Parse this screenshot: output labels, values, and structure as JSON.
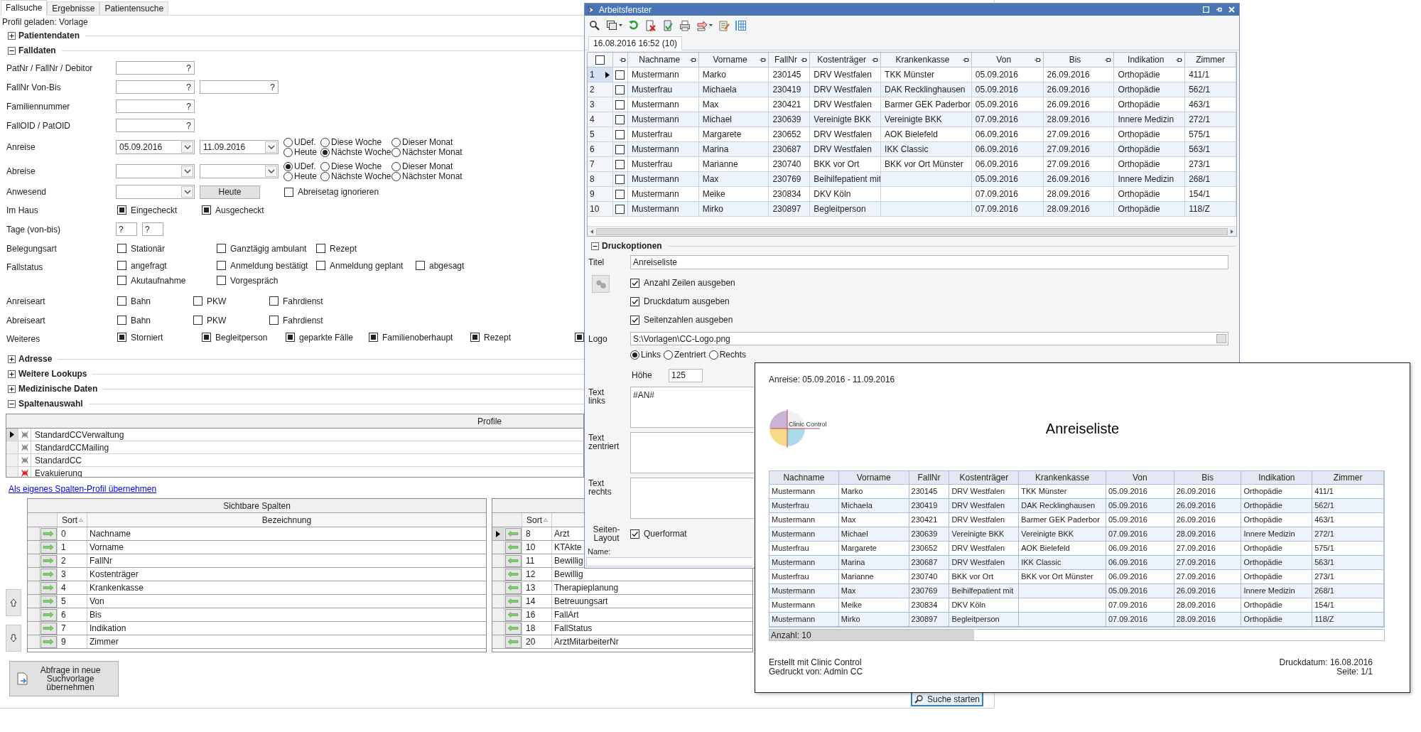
{
  "search_form": {
    "tabs": [
      {
        "label": "Fallsuche",
        "selected": true
      },
      {
        "label": "Ergebnisse",
        "selected": false
      },
      {
        "label": "Patientensuche",
        "selected": false
      }
    ],
    "profile_status": "Profil geladen: Vorlage",
    "sections_before": [
      {
        "label": "Patientendaten",
        "expanded": false
      },
      {
        "label": "Falldaten",
        "expanded": true
      }
    ],
    "falldaten_rows": [
      {
        "label": "PatNr / FallNr / Debitor",
        "items": [
          {
            "kind": "hint_field",
            "value": "?"
          }
        ]
      },
      {
        "label": "FallNr Von-Bis",
        "items": [
          {
            "kind": "hint_field",
            "value": "?"
          },
          {
            "kind": "hint_field",
            "value": "?"
          }
        ]
      },
      {
        "label": "Familiennummer",
        "items": [
          {
            "kind": "hint_field",
            "value": "?"
          }
        ]
      },
      {
        "label": "FallOID / PatOID",
        "items": [
          {
            "kind": "hint_field",
            "value": "?"
          }
        ]
      },
      {
        "label": "Anreise",
        "items": [
          {
            "kind": "date",
            "value": "05.09.2016"
          },
          {
            "kind": "date",
            "value": "11.09.2016"
          },
          {
            "kind": "radios",
            "options": [
              {
                "label": "UDef.",
                "selected": false
              },
              {
                "label": "Heute",
                "selected": false
              },
              {
                "label": "Diese Woche",
                "selected": false
              },
              {
                "label": "Nächste Woche",
                "selected": true
              },
              {
                "label": "Dieser Monat",
                "selected": false
              },
              {
                "label": "Nächster Monat",
                "selected": false
              }
            ]
          }
        ]
      },
      {
        "label": "Abreise",
        "items": [
          {
            "kind": "date"
          },
          {
            "kind": "date"
          },
          {
            "kind": "radios",
            "options": [
              {
                "label": "UDef.",
                "selected": true
              },
              {
                "label": "Heute",
                "selected": false
              },
              {
                "label": "Diese Woche",
                "selected": false
              },
              {
                "label": "Nächste Woche",
                "selected": false
              },
              {
                "label": "Dieser Monat",
                "selected": false
              },
              {
                "label": "Nächster Monat",
                "selected": false
              }
            ]
          }
        ]
      },
      {
        "label": "Anwesend",
        "items": [
          {
            "kind": "date"
          },
          {
            "kind": "button",
            "label": "Heute"
          },
          {
            "kind": "checkbox",
            "label": "Abreisetag ignorieren",
            "checked": false
          }
        ]
      },
      {
        "label": "Im Haus",
        "items": [
          {
            "kind": "checkbox",
            "label": "Eingecheckt",
            "checked": true
          },
          {
            "kind": "checkbox",
            "label": "Ausgecheckt",
            "checked": true
          }
        ]
      },
      {
        "label": "Tage (von-bis)",
        "items": [
          {
            "kind": "small_field",
            "value": "?"
          },
          {
            "kind": "small_field",
            "value": "?"
          }
        ]
      },
      {
        "label": "Belegungsart",
        "items": [
          {
            "kind": "checkbox",
            "label": "Stationär",
            "checked": false
          },
          {
            "kind": "checkbox",
            "label": "Ganztägig ambulant",
            "checked": false
          },
          {
            "kind": "checkbox",
            "label": "Rezept",
            "checked": false
          }
        ]
      },
      {
        "label": "Fallstatus",
        "items": [
          {
            "kind": "checkbox",
            "label": "angefragt",
            "checked": false
          },
          {
            "kind": "checkbox",
            "label": "Anmeldung bestätigt",
            "checked": false
          },
          {
            "kind": "checkbox",
            "label": "Anmeldung geplant",
            "checked": false
          },
          {
            "kind": "checkbox",
            "label": "abgesagt",
            "checked": false
          },
          {
            "kind": "checkbox",
            "label": "Akutaufnahme",
            "checked": false
          },
          {
            "kind": "checkbox",
            "label": "Vorgespräch",
            "checked": false
          }
        ]
      },
      {
        "label": "Anreiseart",
        "items": [
          {
            "kind": "checkbox",
            "label": "Bahn",
            "checked": false
          },
          {
            "kind": "checkbox",
            "label": "PKW",
            "checked": false
          },
          {
            "kind": "checkbox",
            "label": "Fahrdienst",
            "checked": false
          }
        ]
      },
      {
        "label": "Abreiseart",
        "items": [
          {
            "kind": "checkbox",
            "label": "Bahn",
            "checked": false
          },
          {
            "kind": "checkbox",
            "label": "PKW",
            "checked": false
          },
          {
            "kind": "checkbox",
            "label": "Fahrdienst",
            "checked": false
          }
        ]
      },
      {
        "label": "Weiteres",
        "items": [
          {
            "kind": "checkbox",
            "label": "Storniert",
            "checked": true
          },
          {
            "kind": "checkbox",
            "label": "Begleitperson",
            "checked": true
          },
          {
            "kind": "checkbox",
            "label": "geparkte Fälle",
            "checked": true
          },
          {
            "kind": "checkbox",
            "label": "Familienoberhaupt",
            "checked": true
          },
          {
            "kind": "checkbox",
            "label": "Rezept",
            "checked": true
          },
          {
            "kind": "checkbox",
            "checked": true
          }
        ]
      }
    ],
    "sections_after": [
      {
        "label": "Adresse",
        "expanded": false
      },
      {
        "label": "Weitere Lookups",
        "expanded": false
      },
      {
        "label": "Medizinische Daten",
        "expanded": false
      },
      {
        "label": "Spaltenauswahl",
        "expanded": true
      }
    ],
    "profiles": {
      "header": "Profile",
      "rows": [
        {
          "name": "StandardCCVerwaltung",
          "selected": true,
          "color": "#8c8c8c"
        },
        {
          "name": "StandardCCMailing",
          "selected": false,
          "color": "#8c8c8c"
        },
        {
          "name": "StandardCC",
          "selected": false,
          "color": "#8c8c8c"
        },
        {
          "name": "Evakuierung",
          "selected": false,
          "color": "#d8262c"
        }
      ]
    },
    "profile_link": "Als eigenes Spalten-Profil übernehmen",
    "visible_columns": {
      "title": "Sichtbare Spalten",
      "sort_header": "Sort",
      "name_header": "Bezeichnung",
      "rows": [
        {
          "sort": "0",
          "name": "Nachname",
          "selected": false
        },
        {
          "sort": "1",
          "name": "Vorname",
          "selected": false
        },
        {
          "sort": "2",
          "name": "FallNr",
          "selected": false
        },
        {
          "sort": "3",
          "name": "Kostenträger",
          "selected": false
        },
        {
          "sort": "4",
          "name": "Krankenkasse",
          "selected": false
        },
        {
          "sort": "5",
          "name": "Von",
          "selected": false
        },
        {
          "sort": "6",
          "name": "Bis",
          "selected": false
        },
        {
          "sort": "7",
          "name": "Indikation",
          "selected": false
        },
        {
          "sort": "9",
          "name": "Zimmer",
          "selected": false
        }
      ]
    },
    "hidden_columns": {
      "sort_header": "Sort",
      "rows": [
        {
          "sort": "8",
          "name": "Arzt",
          "selected": true
        },
        {
          "sort": "10",
          "name": "KTAkte",
          "selected": false
        },
        {
          "sort": "11",
          "name": "Bewillig",
          "selected": false
        },
        {
          "sort": "12",
          "name": "Bewillig",
          "selected": false
        },
        {
          "sort": "13",
          "name": "Therapieplanung",
          "selected": false
        },
        {
          "sort": "14",
          "name": "Betreuungsart",
          "selected": false
        },
        {
          "sort": "16",
          "name": "FallArt",
          "selected": false
        },
        {
          "sort": "18",
          "name": "FallStatus",
          "selected": false
        },
        {
          "sort": "20",
          "name": "ArztMitarbeiterNr",
          "selected": false
        }
      ]
    },
    "apply_button": "Abfrage in neue Suchvorlage übernehmen",
    "search_button": "Suche starten"
  },
  "work_window": {
    "title": "Arbeitsfenster",
    "tab": "16.08.2016 16:52 (10)",
    "table": {
      "all_checked": false,
      "columns": [
        "Nachname",
        "Vorname",
        "FallNr",
        "Kostenträger",
        "Krankenkasse",
        "Von",
        "Bis",
        "Indikation",
        "Zimmer"
      ],
      "rows": [
        {
          "number": "1",
          "selected": true,
          "checked": false,
          "cells": [
            "Mustermann",
            "Marko",
            "230145",
            "DRV Westfalen",
            "TKK Münster",
            "05.09.2016",
            "26.09.2016",
            "Orthopädie",
            "411/1"
          ]
        },
        {
          "number": "2",
          "selected": false,
          "checked": false,
          "cells": [
            "Musterfrau",
            "Michaela",
            "230419",
            "DRV Westfalen",
            "DAK Recklinghausen",
            "05.09.2016",
            "26.09.2016",
            "Orthopädie",
            "562/1"
          ]
        },
        {
          "number": "3",
          "selected": false,
          "checked": false,
          "cells": [
            "Mustermann",
            "Max",
            "230421",
            "DRV Westfalen",
            "Barmer GEK Paderbor",
            "05.09.2016",
            "26.09.2016",
            "Orthopädie",
            "463/1"
          ]
        },
        {
          "number": "4",
          "selected": false,
          "checked": false,
          "cells": [
            "Mustermann",
            "Michael",
            "230639",
            "Vereinigte BKK",
            "Vereinigte BKK",
            "07.09.2016",
            "28.09.2016",
            "Innere Medizin",
            "272/1"
          ]
        },
        {
          "number": "5",
          "selected": false,
          "checked": false,
          "cells": [
            "Musterfrau",
            "Margarete",
            "230652",
            "DRV Westfalen",
            "AOK Bielefeld",
            "06.09.2016",
            "27.09.2016",
            "Orthopädie",
            "575/1"
          ]
        },
        {
          "number": "6",
          "selected": false,
          "checked": false,
          "cells": [
            "Mustermann",
            "Marina",
            "230687",
            "DRV Westfalen",
            "IKK Classic",
            "06.09.2016",
            "27.09.2016",
            "Orthopädie",
            "563/1"
          ]
        },
        {
          "number": "7",
          "selected": false,
          "checked": false,
          "cells": [
            "Musterfrau",
            "Marianne",
            "230740",
            "BKK vor Ort",
            "BKK vor Ort Münster",
            "06.09.2016",
            "27.09.2016",
            "Orthopädie",
            "273/1"
          ]
        },
        {
          "number": "8",
          "selected": false,
          "checked": false,
          "cells": [
            "Mustermann",
            "Max",
            "230769",
            "Beihilfepatient mit",
            null,
            "05.09.2016",
            "26.09.2016",
            "Innere Medizin",
            "268/1"
          ]
        },
        {
          "number": "9",
          "selected": false,
          "checked": false,
          "cells": [
            "Mustermann",
            "Meike",
            "230834",
            "DKV Köln",
            null,
            "07.09.2016",
            "28.09.2016",
            "Orthopädie",
            "154/1"
          ]
        },
        {
          "number": "10",
          "selected": false,
          "checked": false,
          "cells": [
            "Mustermann",
            "Mirko",
            "230897",
            "Begleitperson",
            null,
            "07.09.2016",
            "28.09.2016",
            "Orthopädie",
            "118/Z"
          ]
        }
      ]
    },
    "print_options": {
      "label": "Druckoptionen",
      "expanded": true,
      "title_label": "Titel",
      "title_value": "Anreiseliste",
      "options": [
        {
          "label": "Anzahl Zeilen ausgeben",
          "checked": true
        },
        {
          "label": "Druckdatum ausgeben",
          "checked": true
        },
        {
          "label": "Seitenzahlen ausgeben",
          "checked": true
        }
      ],
      "logo_label": "Logo",
      "logo_value": "S:\\Vorlagen\\CC-Logo.png",
      "logo_align": [
        {
          "label": "Links",
          "selected": true
        },
        {
          "label": "Zentriert",
          "selected": false
        },
        {
          "label": "Rechts",
          "selected": false
        }
      ],
      "height_label": "Höhe",
      "height_value": "125",
      "texts": [
        {
          "label": "Text\nlinks",
          "value": "#AN#"
        },
        {
          "label": "Text\nzentriert"
        },
        {
          "label": "Text\nrechts"
        }
      ],
      "layout_label": "Seiten-\nLayout",
      "landscape": {
        "label": "Querformat",
        "checked": true
      },
      "name_label": "Name:"
    }
  },
  "print_preview": {
    "range": "Anreise: 05.09.2016 - 11.09.2016",
    "logo_caption": "Clinic Control",
    "title": "Anreiseliste",
    "columns": [
      "Nachname",
      "Vorname",
      "FallNr",
      "Kostenträger",
      "Krankenkasse",
      "Von",
      "Bis",
      "Indikation",
      "Zimmer"
    ],
    "rows": [
      [
        "Mustermann",
        "Marko",
        "230145",
        "DRV Westfalen",
        "TKK Münster",
        "05.09.2016",
        "26.09.2016",
        "Orthopädie",
        "411/1"
      ],
      [
        "Musterfrau",
        "Michaela",
        "230419",
        "DRV Westfalen",
        "DAK Recklinghausen",
        "05.09.2016",
        "26.09.2016",
        "Orthopädie",
        "562/1"
      ],
      [
        "Mustermann",
        "Max",
        "230421",
        "DRV Westfalen",
        "Barmer GEK Paderbor",
        "05.09.2016",
        "26.09.2016",
        "Orthopädie",
        "463/1"
      ],
      [
        "Mustermann",
        "Michael",
        "230639",
        "Vereinigte BKK",
        "Vereinigte BKK",
        "07.09.2016",
        "28.09.2016",
        "Innere Medizin",
        "272/1"
      ],
      [
        "Musterfrau",
        "Margarete",
        "230652",
        "DRV Westfalen",
        "AOK Bielefeld",
        "06.09.2016",
        "27.09.2016",
        "Orthopädie",
        "575/1"
      ],
      [
        "Mustermann",
        "Marina",
        "230687",
        "DRV Westfalen",
        "IKK Classic",
        "06.09.2016",
        "27.09.2016",
        "Orthopädie",
        "563/1"
      ],
      [
        "Musterfrau",
        "Marianne",
        "230740",
        "BKK vor Ort",
        "BKK vor Ort Münster",
        "06.09.2016",
        "27.09.2016",
        "Orthopädie",
        "273/1"
      ],
      [
        "Mustermann",
        "Max",
        "230769",
        "Beihilfepatient mit",
        null,
        "05.09.2016",
        "26.09.2016",
        "Innere Medizin",
        "268/1"
      ],
      [
        "Mustermann",
        "Meike",
        "230834",
        "DKV Köln",
        null,
        "07.09.2016",
        "28.09.2016",
        "Orthopädie",
        "154/1"
      ],
      [
        "Mustermann",
        "Mirko",
        "230897",
        "Begleitperson",
        null,
        "07.09.2016",
        "28.09.2016",
        "Orthopädie",
        "118/Z"
      ]
    ],
    "count": "Anzahl: 10",
    "footer_left": [
      "Erstellt mit Clinic Control",
      "Gedruckt von: Admin CC"
    ],
    "footer_right": [
      "Druckdatum: 16.08.2016",
      "Seite: 1/1"
    ]
  }
}
